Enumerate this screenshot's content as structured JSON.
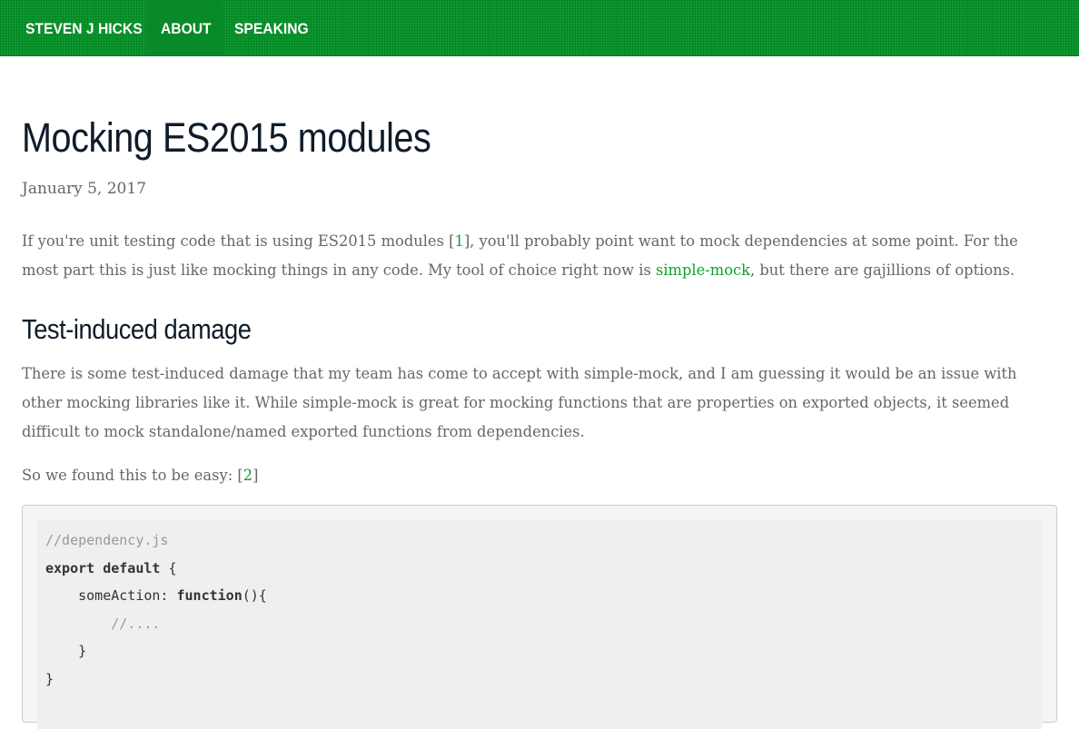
{
  "nav": {
    "brand": "STEVEN J HICKS",
    "about": "ABOUT",
    "speaking": "SPEAKING",
    "background_color": "#0a9a2e"
  },
  "post": {
    "title": "Mocking ES2015 modules",
    "date": "January 5, 2017",
    "intro": {
      "part1": "If you're unit testing code that is using ES2015 modules [",
      "ref1": "1",
      "part2": "], you'll probably point want to mock dependencies at some point. For the most part this is just like mocking things in any code. My tool of choice right now is ",
      "link": "simple-mock",
      "part3": ", but there are gajillions of options."
    },
    "section_heading": "Test-induced damage",
    "section_para": "There is some test-induced damage that my team has come to accept with simple-mock, and I am guessing it would be an issue with other mocking libraries like it. While simple-mock is great for mocking functions that are properties on exported objects, it seemed difficult to mock standalone/named exported functions from dependencies.",
    "easy": {
      "part1": "So we found this to be easy: [",
      "ref2": "2",
      "part2": "]"
    },
    "code": {
      "line1": "//dependency.js",
      "line2_kw": "export default",
      "line2_rest": " {",
      "line3_pre": "    someAction: ",
      "line3_kw": "function",
      "line3_rest": "(){",
      "line4": "        //....",
      "line5": "    }",
      "line6": "}"
    }
  },
  "colors": {
    "link": "#11a22e",
    "heading": "#0f1b2a",
    "body_text": "#666666"
  }
}
